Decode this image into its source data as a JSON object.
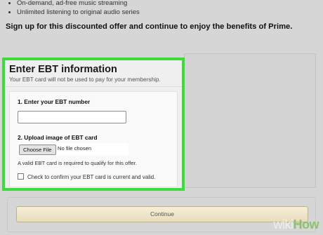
{
  "benefits": {
    "items": [
      "On-demand, ad-free music streaming",
      "Unlimited listening to original audio series"
    ],
    "signup_text": "Sign up for this discounted offer and continue to enjoy the benefits of Prime."
  },
  "ebt_panel": {
    "title": "Enter EBT information",
    "subtitle": "Your EBT card will not be used to pay for your membership.",
    "step1_label": "1. Enter your EBT number",
    "ebt_number_value": "",
    "step2_label": "2. Upload image of EBT card",
    "choose_file_label": "Choose File",
    "no_file_label": "No file chosen",
    "requirement_note": "A valid EBT card is required to qualify for this offer.",
    "confirm_label": "Check to confirm your EBT card is current and valid.",
    "confirm_checked": false
  },
  "actions": {
    "continue_label": "Continue"
  },
  "watermark": {
    "part1": "wiki",
    "part2": "How"
  },
  "colors": {
    "highlight_border": "#3ddb3d",
    "continue_button": "#efe5c8"
  }
}
